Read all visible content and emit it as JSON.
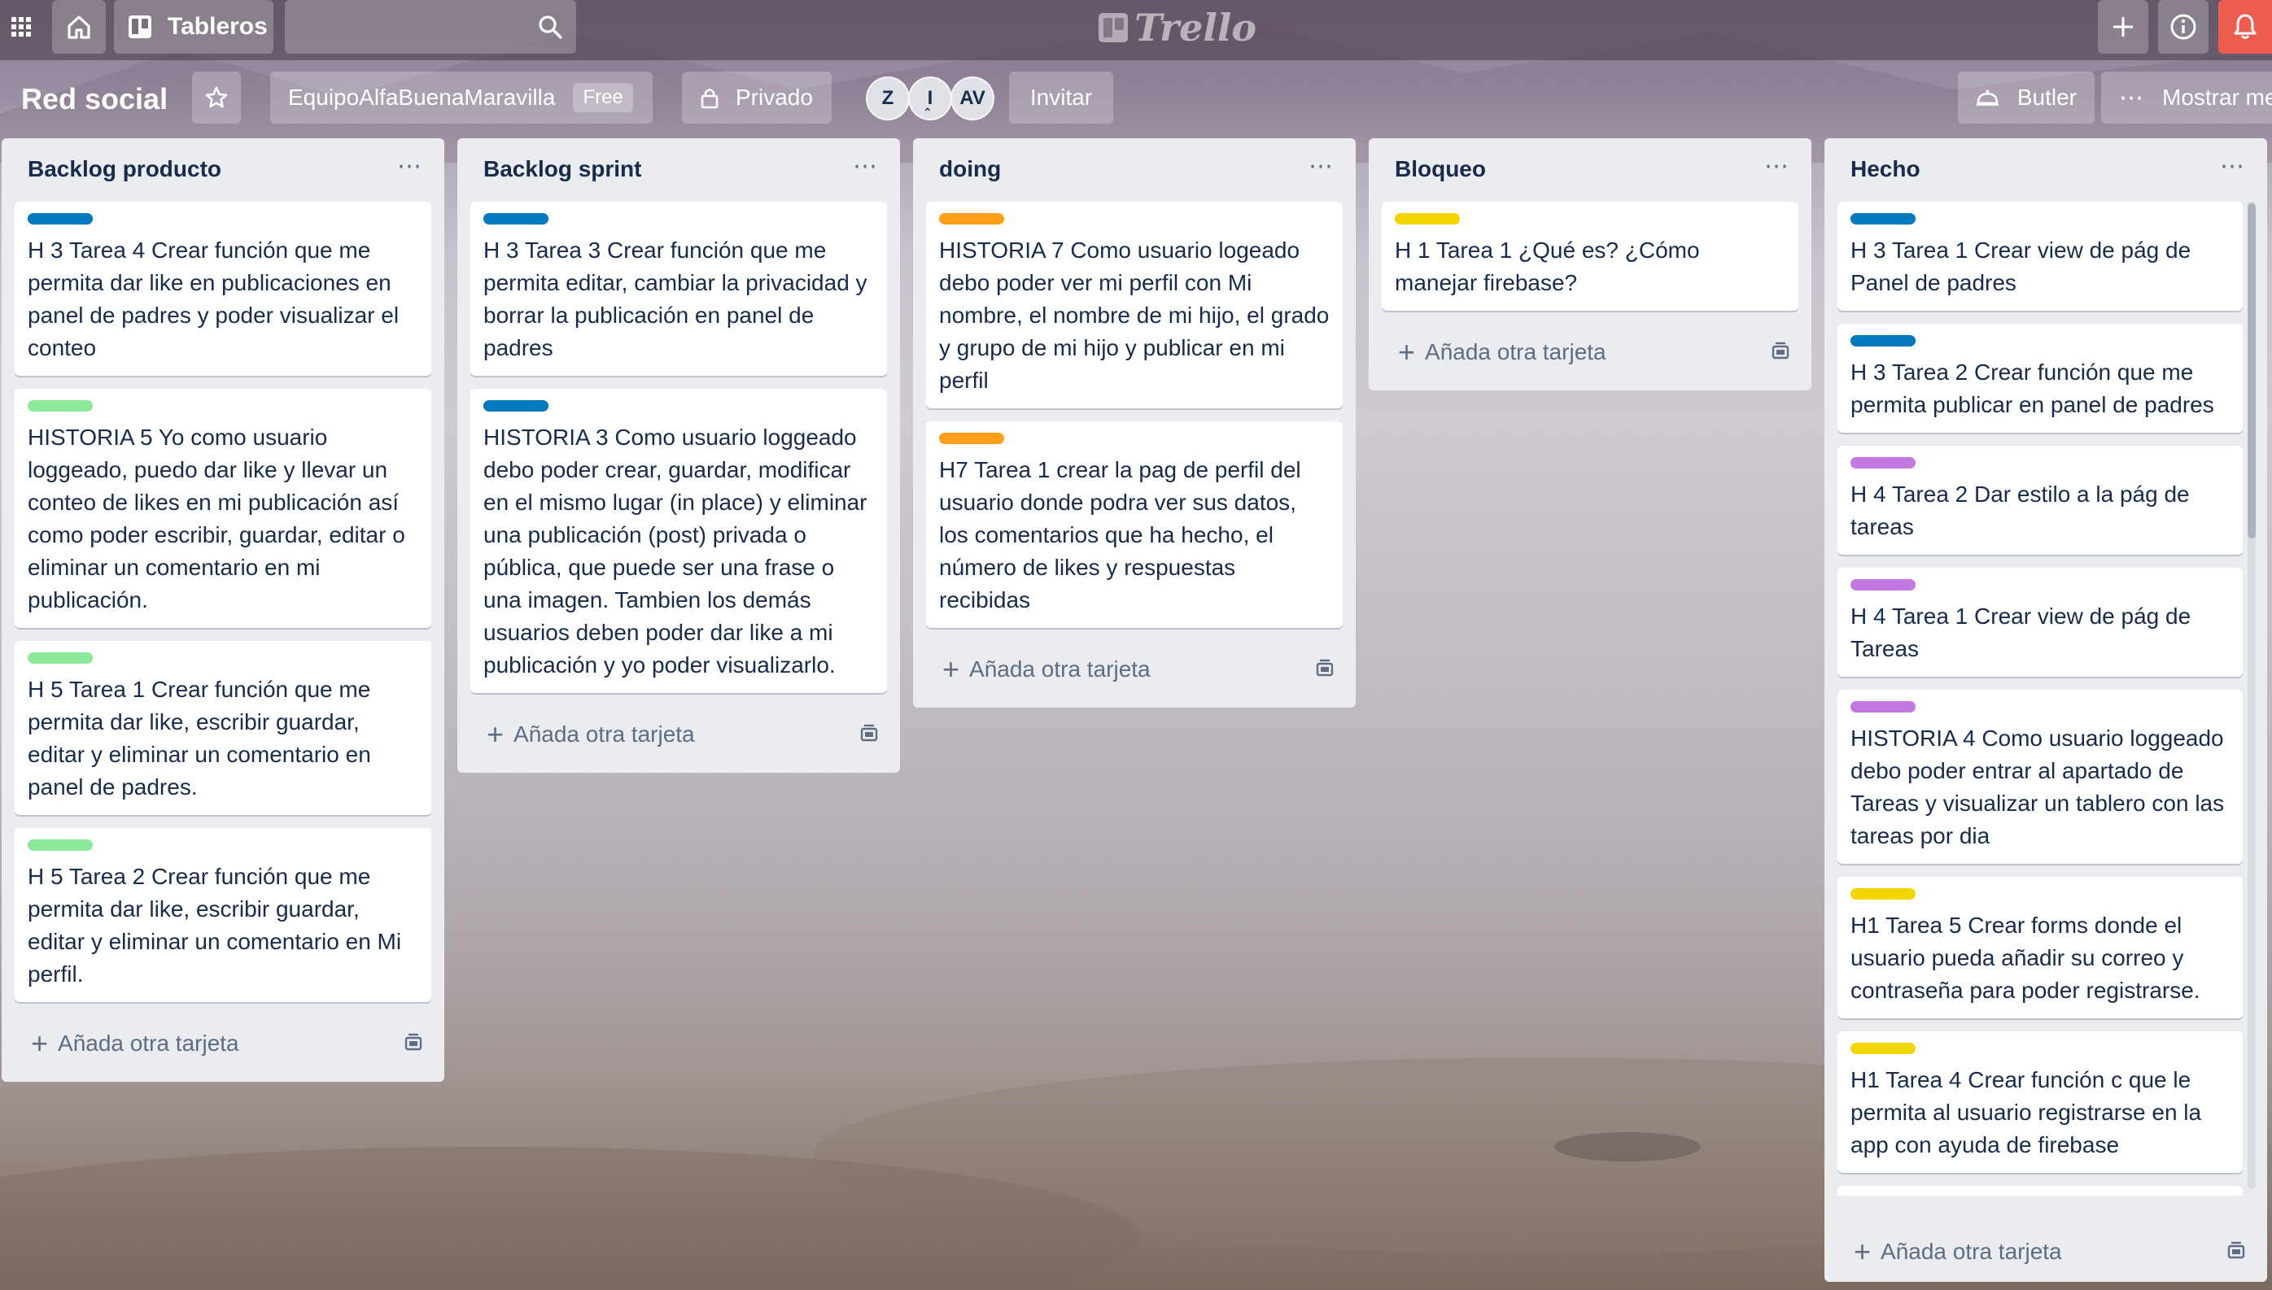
{
  "topbar": {
    "apps_icon": "grid-icon",
    "home_icon": "home-icon",
    "boards_label": "Tableros",
    "search_value": "",
    "logo_text": "Trello",
    "plus_icon": "plus-icon",
    "info_icon": "info-icon",
    "bell_icon": "bell-icon"
  },
  "board": {
    "title": "Red social",
    "team_name": "EquipoAlfaBuenaMaravilla",
    "team_badge": "Free",
    "visibility": "Privado",
    "members": [
      "Z",
      "I",
      "AV"
    ],
    "invite_label": "Invitar",
    "butler_label": "Butler",
    "menu_label": "Mostrar me"
  },
  "colors": {
    "blue": "#0079bf",
    "green": "#61bd4f",
    "light_green": "#8ce99a",
    "orange": "#ff9f1a",
    "yellow": "#f2d600",
    "purple": "#c377e0",
    "bell_bg": "#ec5c4f",
    "list_bg": "#ebecf0"
  },
  "add_card_label": "Añada otra tarjeta",
  "lists": [
    {
      "title": "Backlog producto",
      "cards": [
        {
          "label": "blue",
          "text": "H 3 Tarea 4 Crear función que me permita dar like en publicaciones en panel de padres y poder visualizar el conteo"
        },
        {
          "label": "light_green",
          "text": "HISTORIA 5 Yo como usuario loggeado, puedo dar like y llevar un conteo de likes en mi publicación así como poder escribir, guardar, editar o eliminar un comentario en mi publicación."
        },
        {
          "label": "light_green",
          "text": "H 5 Tarea 1 Crear función que me permita dar like, escribir guardar, editar y eliminar un comentario en panel de padres."
        },
        {
          "label": "light_green",
          "text": "H 5 Tarea 2 Crear función que me permita dar like, escribir guardar, editar y eliminar un comentario en Mi perfil."
        }
      ]
    },
    {
      "title": "Backlog sprint",
      "cards": [
        {
          "label": "blue",
          "text": "H 3 Tarea 3 Crear función que me permita editar, cambiar la privacidad y borrar la publicación en panel de padres"
        },
        {
          "label": "blue",
          "text": "HISTORIA 3 Como usuario loggeado debo poder crear, guardar, modificar en el mismo lugar (in place) y eliminar una publicación (post) privada o pública, que puede ser una frase o una imagen. Tambien los demás usuarios deben poder dar like a mi publicación y yo poder visualizarlo."
        }
      ]
    },
    {
      "title": "doing",
      "cards": [
        {
          "label": "orange",
          "text": "HISTORIA 7 Como usuario logeado debo poder ver mi perfil con Mi nombre, el nombre de mi hijo, el grado y grupo de mi hijo y publicar en mi perfil"
        },
        {
          "label": "orange",
          "text": "H7 Tarea 1 crear la pag de perfil del usuario donde podra ver sus datos, los comentarios que ha hecho, el número de likes y respuestas recibidas"
        }
      ]
    },
    {
      "title": "Bloqueo",
      "cards": [
        {
          "label": "yellow",
          "text": "H 1 Tarea 1 ¿Qué es? ¿Cómo manejar firebase?"
        }
      ]
    },
    {
      "title": "Hecho",
      "cards": [
        {
          "label": "blue",
          "text": "H 3 Tarea 1 Crear view de pág de Panel de padres"
        },
        {
          "label": "blue",
          "text": "H 3 Tarea 2 Crear función que me permita publicar en panel de padres"
        },
        {
          "label": "purple",
          "text": "H 4 Tarea 2 Dar estilo a la pág de tareas"
        },
        {
          "label": "purple",
          "text": "H 4 Tarea 1 Crear view de pág de Tareas"
        },
        {
          "label": "purple",
          "text": "HISTORIA 4 Como usuario loggeado debo poder entrar al apartado de Tareas y visualizar un tablero con las tareas por dia"
        },
        {
          "label": "yellow",
          "text": "H1 Tarea 5 Crear forms donde el usuario pueda añadir su correo y contraseña para poder registrarse."
        },
        {
          "label": "yellow",
          "text": "H1 Tarea 4 Crear función c que le permita al usuario registrarse en la app con ayuda de firebase"
        },
        {
          "label": "yellow",
          "text": ""
        }
      ]
    }
  ]
}
